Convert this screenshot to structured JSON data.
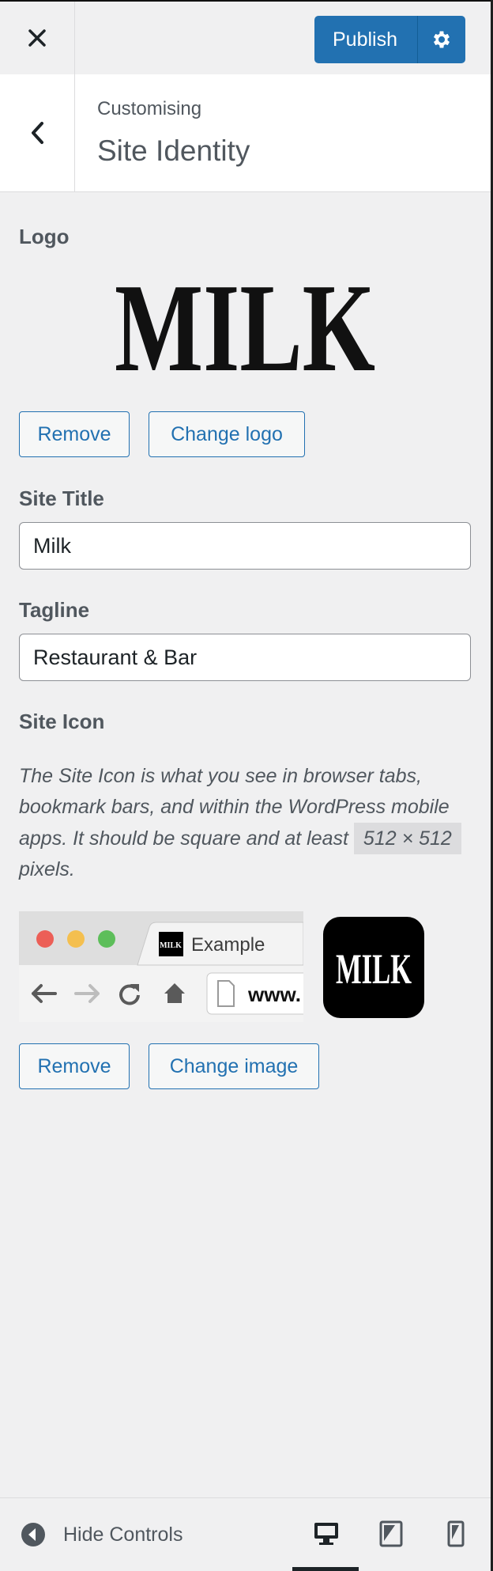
{
  "topbar": {
    "close_icon": "close-icon",
    "publish_label": "Publish",
    "settings_icon": "gear-icon"
  },
  "header": {
    "breadcrumb": "Customising",
    "title": "Site Identity"
  },
  "logo": {
    "label": "Logo",
    "image_text": "MILK",
    "remove_label": "Remove",
    "change_label": "Change logo"
  },
  "site_title": {
    "label": "Site Title",
    "value": "Milk"
  },
  "tagline": {
    "label": "Tagline",
    "value": "Restaurant & Bar"
  },
  "site_icon": {
    "label": "Site Icon",
    "description_pre": "The Site Icon is what you see in browser tabs, bookmark bars, and within the WordPress mobile apps. It should be square and at least",
    "dimensions": "512 × 512",
    "description_post": "pixels.",
    "preview_tab_label": "Example",
    "preview_url": "www.",
    "icon_text": "MILK",
    "remove_label": "Remove",
    "change_label": "Change image"
  },
  "footer": {
    "hide_controls_label": "Hide Controls",
    "devices": [
      "desktop",
      "tablet",
      "mobile"
    ],
    "active_device": "desktop"
  },
  "colors": {
    "accent": "#2271b1",
    "panel_bg": "#f0f0f1",
    "text": "#50575e"
  }
}
